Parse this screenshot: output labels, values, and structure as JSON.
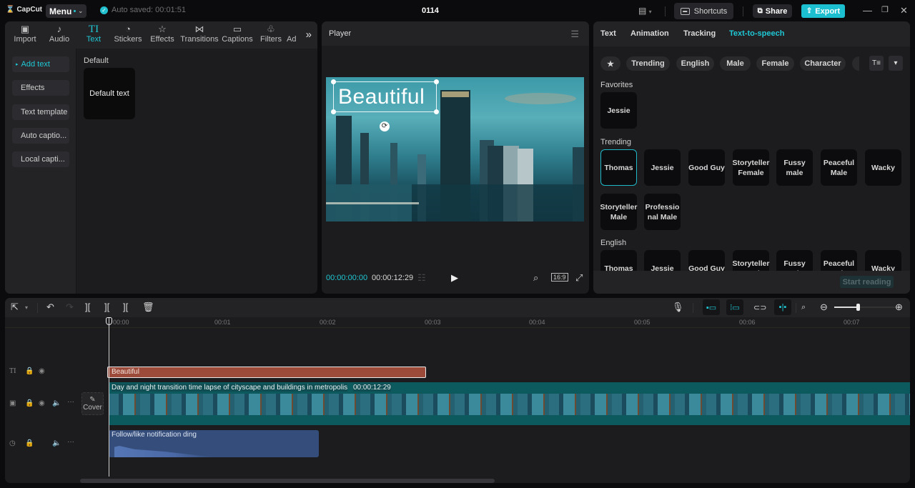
{
  "titlebar": {
    "app_name": "CapCut",
    "menu_label": "Menu",
    "autosave_text": "Auto saved: 00:01:51",
    "project_title": "0114",
    "shortcuts_label": "Shortcuts",
    "share_label": "Share",
    "export_label": "Export",
    "accent_color": "#1fc7d4"
  },
  "left_panel": {
    "tabs": [
      {
        "label": "Import",
        "icon": "import-icon",
        "glyph": "▣"
      },
      {
        "label": "Audio",
        "icon": "audio-icon",
        "glyph": "♪"
      },
      {
        "label": "Text",
        "icon": "text-icon",
        "glyph": "TI",
        "active": true
      },
      {
        "label": "Stickers",
        "icon": "sticker-icon",
        "glyph": "◔"
      },
      {
        "label": "Effects",
        "icon": "effects-icon",
        "glyph": "☆"
      },
      {
        "label": "Transitions",
        "icon": "transitions-icon",
        "glyph": "⋈"
      },
      {
        "label": "Captions",
        "icon": "captions-icon",
        "glyph": "▭"
      },
      {
        "label": "Filters",
        "icon": "filters-icon",
        "glyph": "♧"
      },
      {
        "label": "Ad",
        "icon": "adjust-icon",
        "glyph": ""
      }
    ],
    "nav": [
      "Add text",
      "Effects",
      "Text template",
      "Auto captio...",
      "Local capti..."
    ],
    "section_label": "Default",
    "default_card_text": "Default text"
  },
  "player": {
    "title": "Player",
    "overlay_text": "Beautiful",
    "current_time": "00:00:00:00",
    "total_time": "00:00:12:29",
    "aspect_ratio": "16:9"
  },
  "right_panel": {
    "tabs": [
      "Text",
      "Animation",
      "Tracking",
      "Text-to-speech"
    ],
    "active_tab": "Text-to-speech",
    "chips": [
      "Trending",
      "English",
      "Male",
      "Female",
      "Character"
    ],
    "favorites_label": "Favorites",
    "favorites": [
      "Jessie"
    ],
    "trending_label": "Trending",
    "trending": [
      "Thomas",
      "Jessie",
      "Good Guy",
      "Storyteller Female",
      "Fussy male",
      "Peaceful Male",
      "Wacky",
      "Storyteller Male",
      "Professio nal Male"
    ],
    "selected_voice": "Thomas",
    "english_label": "English",
    "english": [
      "Thomas",
      "Jessie",
      "Good Guy",
      "Storyteller Female",
      "Fussy male",
      "Peaceful Male",
      "Wacky"
    ],
    "start_reading_label": "Start reading"
  },
  "timeline": {
    "ruler_labels": [
      "00:00",
      "00:01",
      "00:02",
      "00:03",
      "00:04",
      "00:05",
      "00:06",
      "00:07"
    ],
    "text_clip_label": "Beautiful",
    "video_clip_label": "Day and night transition time lapse of cityscape and buildings in metropolis",
    "video_clip_duration": "00:00:12:29",
    "audio_clip_label": "Follow/like notification ding",
    "cover_label": "Cover",
    "zoom_level": 0.35,
    "text_clip_color": "#9c4a3a",
    "video_clip_color": "#0c5a5e",
    "audio_clip_color": "#344d7a"
  }
}
